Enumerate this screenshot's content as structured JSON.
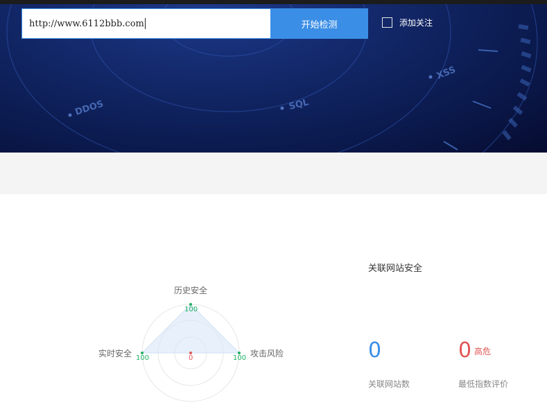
{
  "search": {
    "value": "http://www.6112bbb.com",
    "button_label": "开始检测",
    "follow_label": "添加关注",
    "follow_checked": false
  },
  "banner": {
    "labels": [
      "DDOS",
      "SQL",
      "XSS"
    ],
    "background_color": "#0b1a4e"
  },
  "radar": {
    "axes": [
      {
        "label": "历史安全",
        "value": 100
      },
      {
        "label": "攻击风险",
        "value": 100
      },
      {
        "label": "实时安全",
        "value": 100
      }
    ],
    "center_value": "0",
    "value_color": "#1faf62",
    "zero_color": "#e25555"
  },
  "association": {
    "title": "关联网站安全",
    "site_count": "0",
    "site_count_label": "关联网站数",
    "min_score": "0",
    "min_score_level": "高危",
    "min_score_label": "最低指数评价"
  },
  "colors": {
    "accent": "#3a8ee6",
    "danger": "#e25555",
    "success": "#1faf62"
  }
}
